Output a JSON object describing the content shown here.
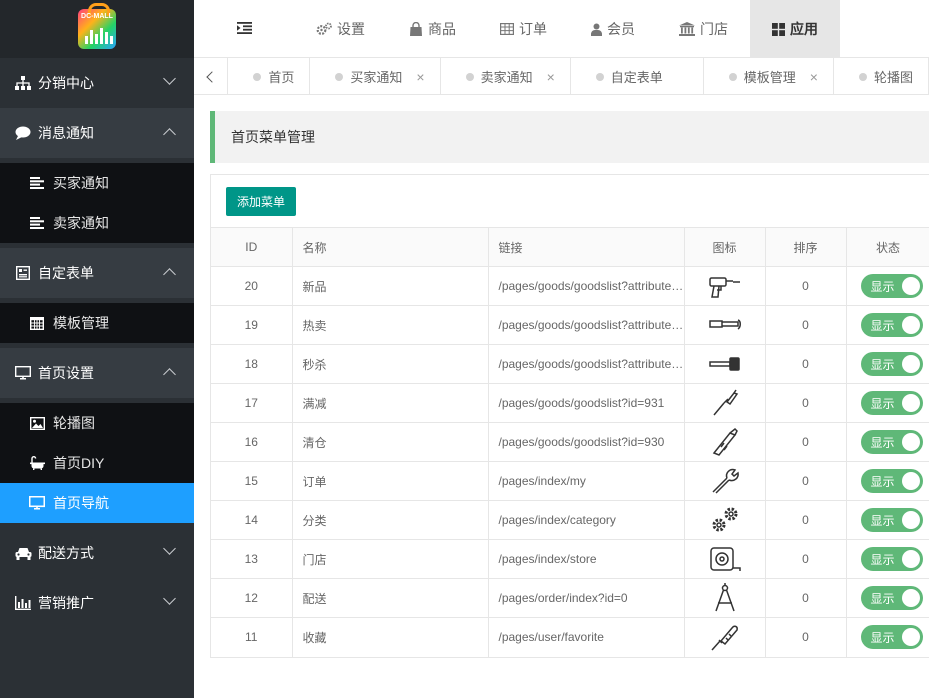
{
  "logo": {
    "text": "DC-MALL"
  },
  "sidebar": {
    "groups": [
      {
        "label": "分销中心",
        "icon": "sitemap-icon",
        "open": false,
        "children": []
      },
      {
        "label": "消息通知",
        "icon": "chat-bubble-icon",
        "open": true,
        "children": [
          {
            "label": "买家通知",
            "icon": "list-icon"
          },
          {
            "label": "卖家通知",
            "icon": "list-icon"
          }
        ]
      },
      {
        "label": "自定表单",
        "icon": "form-icon",
        "open": true,
        "children": [
          {
            "label": "模板管理",
            "icon": "calendar-icon"
          }
        ]
      },
      {
        "label": "首页设置",
        "icon": "monitor-icon",
        "open": true,
        "children": [
          {
            "label": "轮播图",
            "icon": "image-icon"
          },
          {
            "label": "首页DIY",
            "icon": "bath-icon"
          },
          {
            "label": "首页导航",
            "icon": "desktop-icon",
            "active": true
          }
        ]
      },
      {
        "label": "配送方式",
        "icon": "car-icon",
        "open": false,
        "children": []
      },
      {
        "label": "营销推广",
        "icon": "bar-chart-icon",
        "open": false,
        "children": []
      }
    ]
  },
  "topnav": {
    "items": [
      {
        "label": "设置",
        "icon": "gears-icon"
      },
      {
        "label": "商品",
        "icon": "shopping-bag-icon"
      },
      {
        "label": "订单",
        "icon": "table-icon"
      },
      {
        "label": "会员",
        "icon": "user-icon"
      },
      {
        "label": "门店",
        "icon": "bank-icon"
      },
      {
        "label": "应用",
        "icon": "grid-icon",
        "active": true
      }
    ]
  },
  "tabs": [
    {
      "label": "首页",
      "closable": false
    },
    {
      "label": "买家通知",
      "closable": true
    },
    {
      "label": "卖家通知",
      "closable": true
    },
    {
      "label": "自定表单",
      "closable": false
    },
    {
      "label": "模板管理",
      "closable": true
    },
    {
      "label": "轮播图",
      "closable": false
    }
  ],
  "tab_close_glyph": "×",
  "page": {
    "title": "首页菜单管理",
    "add_button": "添加菜单"
  },
  "table": {
    "headers": [
      "ID",
      "名称",
      "链接",
      "图标",
      "排序",
      "状态"
    ],
    "status_label": "显示",
    "rows": [
      {
        "id": "20",
        "name": "新品",
        "link": "/pages/goods/goodslist?attribute=new",
        "icon": "drill-icon",
        "sort": "0"
      },
      {
        "id": "19",
        "name": "热卖",
        "link": "/pages/goods/goodslist?attribute=hot",
        "icon": "hammer-icon",
        "sort": "0"
      },
      {
        "id": "18",
        "name": "秒杀",
        "link": "/pages/goods/goodslist?attribute=seckill",
        "icon": "mallet-icon",
        "sort": "0"
      },
      {
        "id": "17",
        "name": "满减",
        "link": "/pages/goods/goodslist?id=931",
        "icon": "screwdriver-icon",
        "sort": "0"
      },
      {
        "id": "16",
        "name": "清仓",
        "link": "/pages/goods/goodslist?id=930",
        "icon": "cutter-icon",
        "sort": "0"
      },
      {
        "id": "15",
        "name": "订单",
        "link": "/pages/index/my",
        "icon": "wrench-icon",
        "sort": "0"
      },
      {
        "id": "14",
        "name": "分类",
        "link": "/pages/index/category",
        "icon": "cogs-icon",
        "sort": "0"
      },
      {
        "id": "13",
        "name": "门店",
        "link": "/pages/index/store",
        "icon": "tape-measure-icon",
        "sort": "0"
      },
      {
        "id": "12",
        "name": "配送",
        "link": "/pages/order/index?id=0",
        "icon": "compass-icon",
        "sort": "0"
      },
      {
        "id": "11",
        "name": "收藏",
        "link": "/pages/user/favorite",
        "icon": "soldering-iron-icon",
        "sort": "0"
      }
    ]
  },
  "colors": {
    "sidebar_bg": "#2b3035",
    "active_blue": "#1e9fff",
    "title_accent": "#5fb878",
    "button_teal": "#009688",
    "switch_green": "#5fb878"
  }
}
